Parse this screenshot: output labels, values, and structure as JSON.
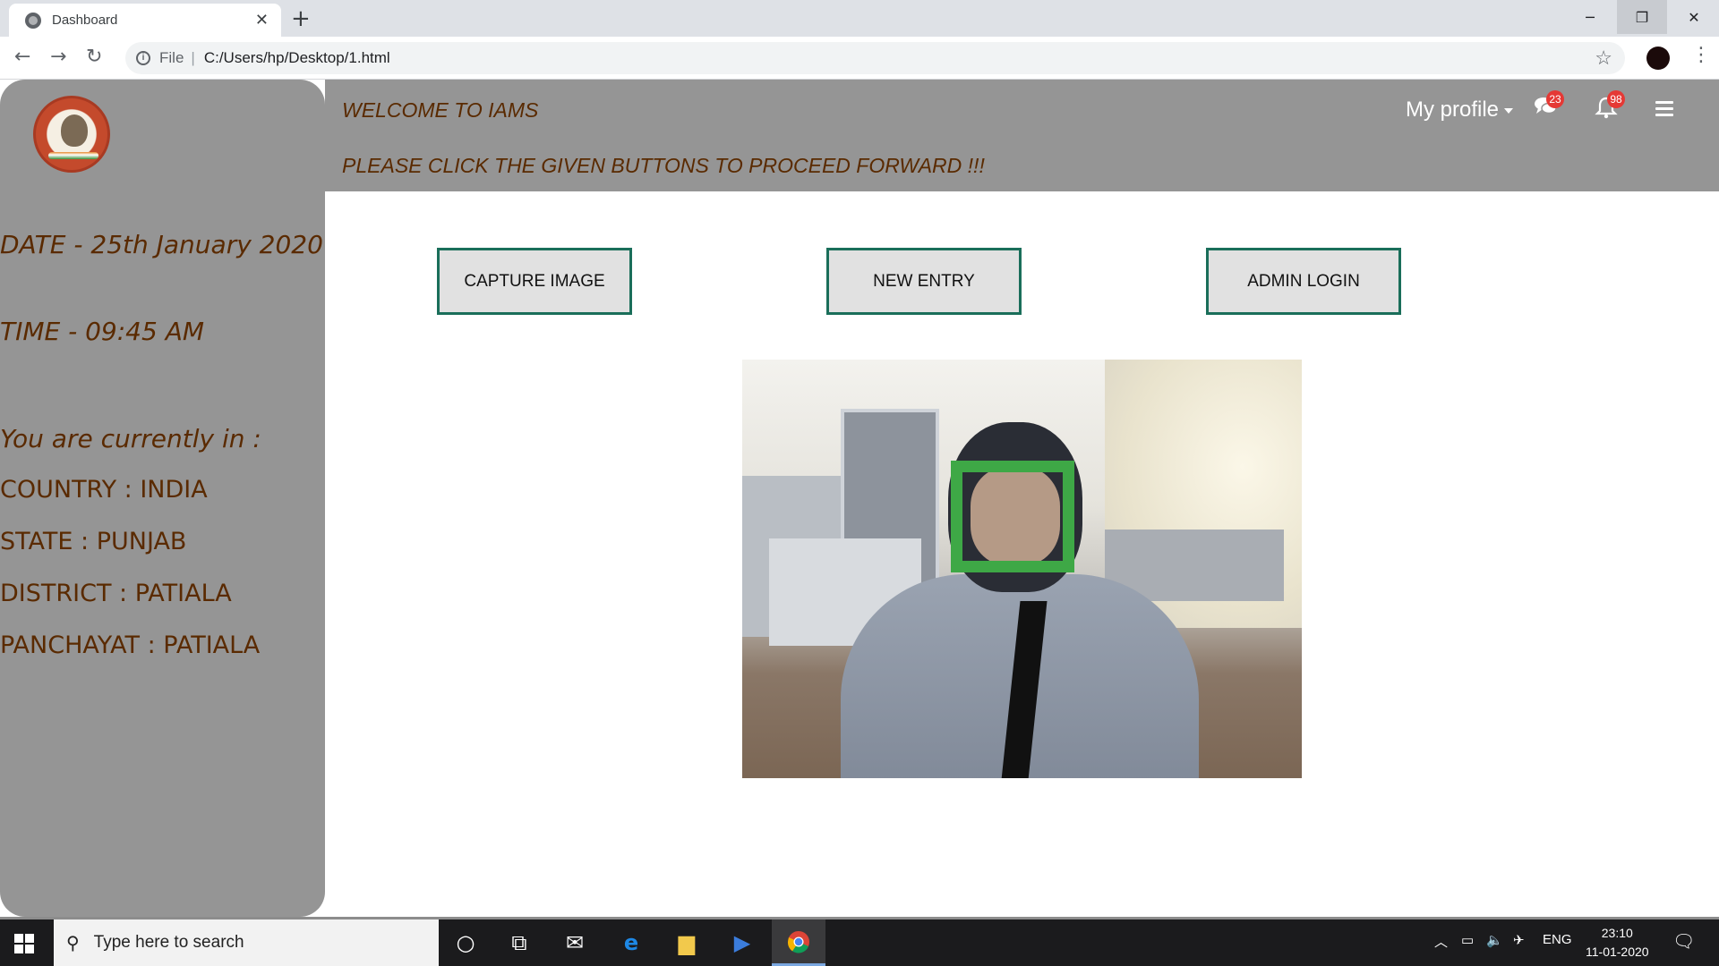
{
  "browser": {
    "tab_title": "Dashboard",
    "file_label": "File",
    "url": "C:/Users/hp/Desktop/1.html"
  },
  "sidebar": {
    "date": "DATE - 25th January 2020",
    "time": "TIME - 09:45 AM",
    "location_heading": "You are currently in :",
    "country": "COUNTRY : INDIA",
    "state": "STATE : PUNJAB",
    "district": "DISTRICT : PATIALA",
    "panchayat": "PANCHAYAT : PATIALA"
  },
  "header": {
    "welcome": "WELCOME TO IAMS",
    "instruction": "PLEASE CLICK THE GIVEN BUTTONS TO PROCEED FORWARD !!!",
    "profile_label": "My profile",
    "messages_count": "23",
    "notifications_count": "98"
  },
  "actions": {
    "capture": "CAPTURE IMAGE",
    "new_entry": "NEW ENTRY",
    "admin_login": "ADMIN LOGIN"
  },
  "colors": {
    "panel_gray": "#959595",
    "text_brown": "#5a2a00",
    "button_border": "#1a6e5a",
    "detection_box": "#3ea846",
    "badge_red": "#e53935"
  },
  "taskbar": {
    "search_placeholder": "Type here to search",
    "language": "ENG",
    "time": "23:10",
    "date": "11-01-2020"
  }
}
